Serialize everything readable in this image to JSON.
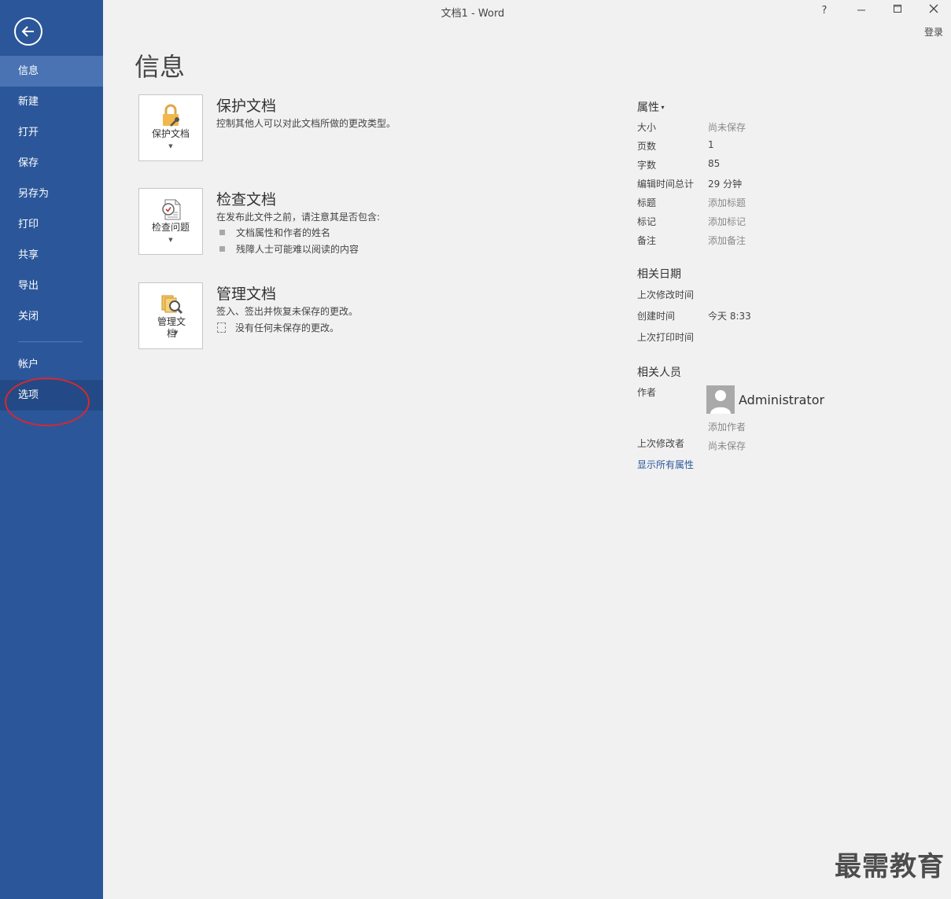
{
  "window": {
    "title": "文档1 - Word",
    "help_icon": "?",
    "signin_label": "登录"
  },
  "sidebar": {
    "back_icon": "back-arrow-icon",
    "items": [
      {
        "label": "信息",
        "active": true
      },
      {
        "label": "新建"
      },
      {
        "label": "打开"
      },
      {
        "label": "保存"
      },
      {
        "label": "另存为"
      },
      {
        "label": "打印"
      },
      {
        "label": "共享"
      },
      {
        "label": "导出"
      },
      {
        "label": "关闭"
      }
    ],
    "bottom_items": [
      {
        "label": "帐户"
      },
      {
        "label": "选项",
        "highlighted": true
      }
    ],
    "bg_color": "#2b579a"
  },
  "main": {
    "title": "信息",
    "sections": [
      {
        "tile_label": "保护文档",
        "heading": "保护文档",
        "description": "控制其他人可以对此文档所做的更改类型。"
      },
      {
        "tile_label": "检查问题",
        "heading": "检查文档",
        "description": "在发布此文件之前，请注意其是否包含:",
        "bullets": [
          "文档属性和作者的姓名",
          "残障人士可能难以阅读的内容"
        ]
      },
      {
        "tile_label": "管理文档",
        "heading": "管理文档",
        "description": "签入、签出并恢复未保存的更改。",
        "note": "没有任何未保存的更改。"
      }
    ]
  },
  "properties": {
    "heading": "属性",
    "rows": [
      {
        "label": "大小",
        "value": "尚未保存",
        "muted": true
      },
      {
        "label": "页数",
        "value": "1"
      },
      {
        "label": "字数",
        "value": "85"
      },
      {
        "label": "编辑时间总计",
        "value": "29 分钟"
      },
      {
        "label": "标题",
        "value": "添加标题",
        "muted": true
      },
      {
        "label": "标记",
        "value": "添加标记",
        "muted": true
      },
      {
        "label": "备注",
        "value": "添加备注",
        "muted": true
      }
    ],
    "dates_heading": "相关日期",
    "dates": [
      {
        "label": "上次修改时间",
        "value": ""
      },
      {
        "label": "创建时间",
        "value": "今天 8:33"
      },
      {
        "label": "上次打印时间",
        "value": ""
      }
    ],
    "people_heading": "相关人员",
    "author_label": "作者",
    "author_name": "Administrator",
    "add_author": "添加作者",
    "last_modified_by_label": "上次修改者",
    "last_modified_by_value": "尚未保存",
    "show_all": "显示所有属性"
  },
  "watermark": "最需教育"
}
